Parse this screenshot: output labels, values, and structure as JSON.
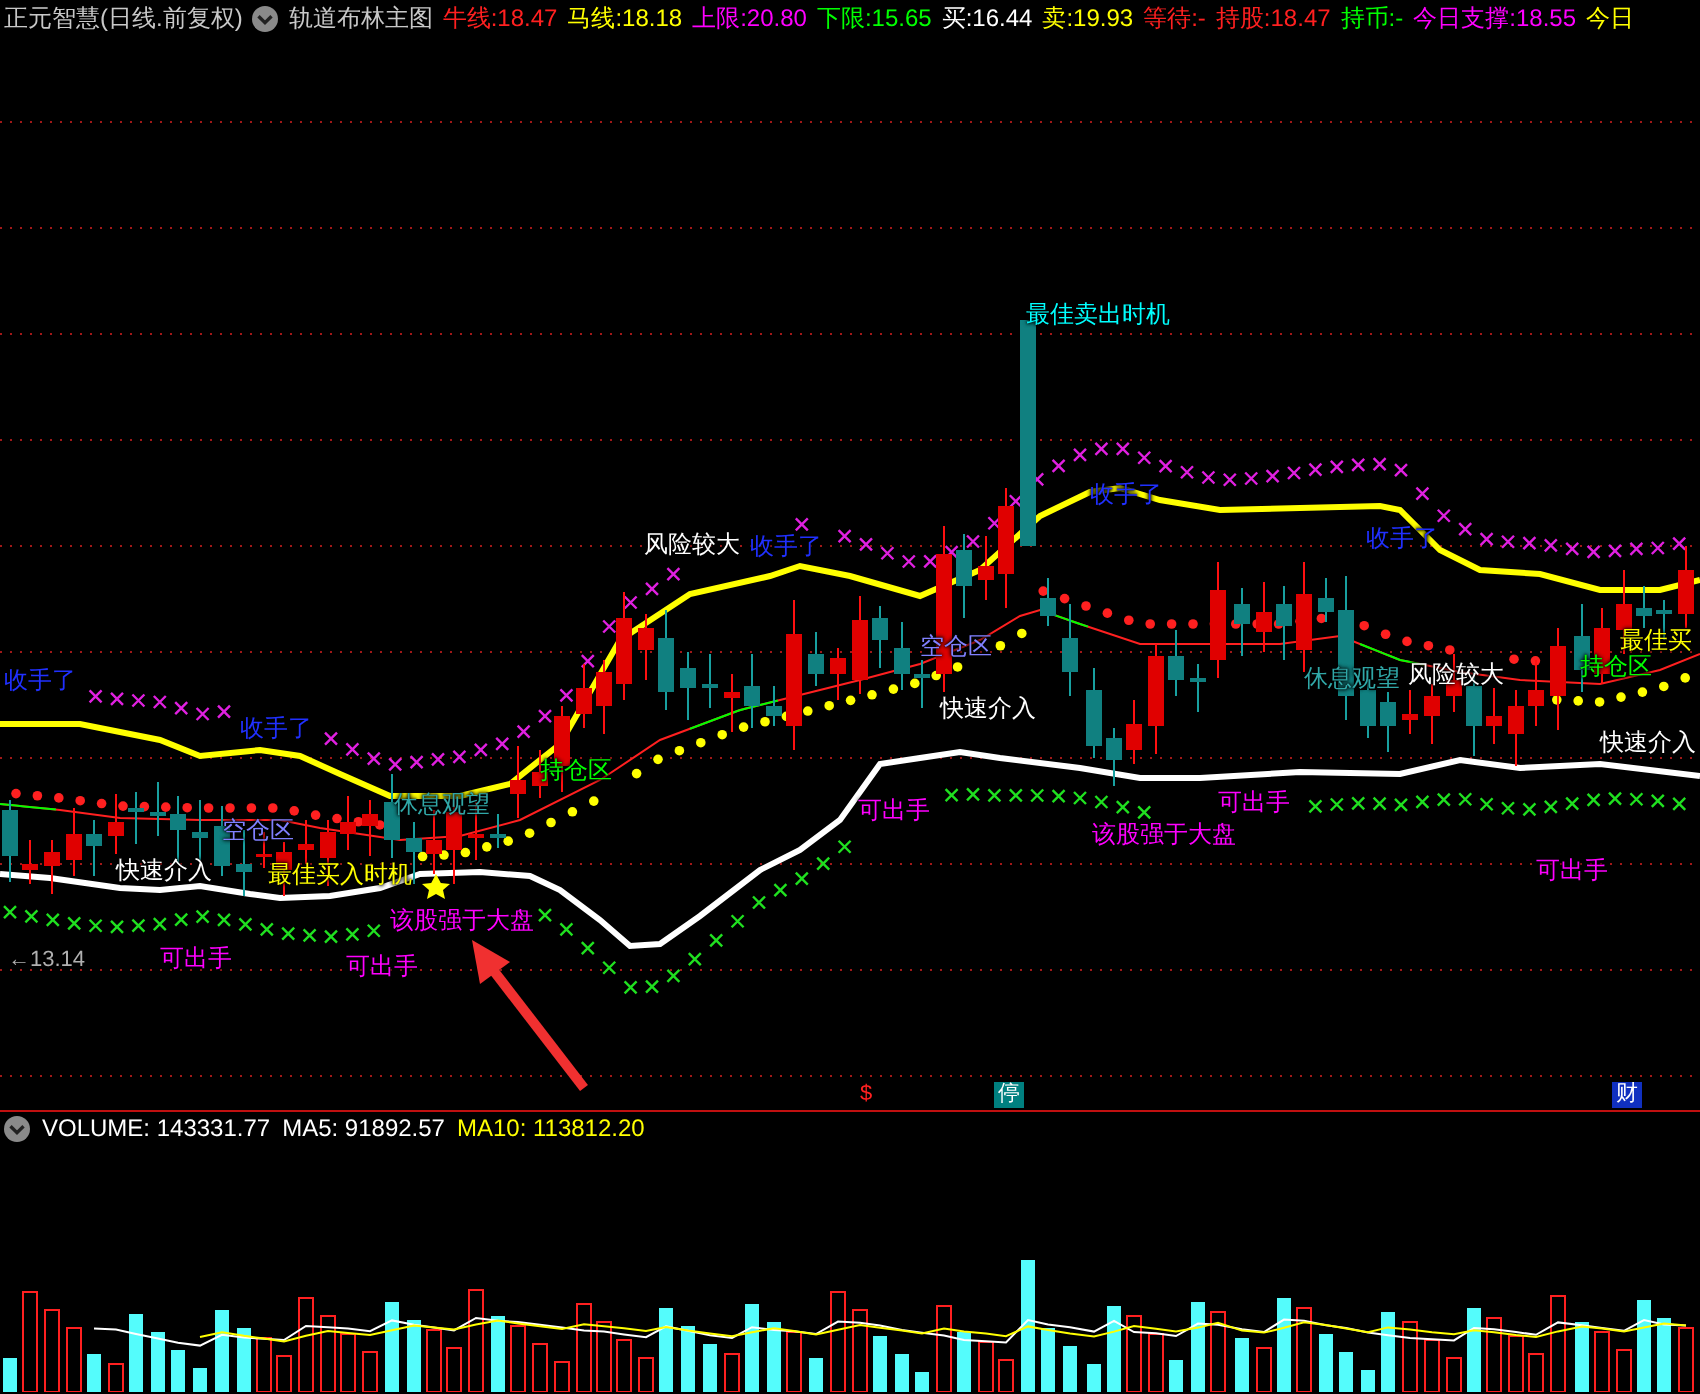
{
  "header": {
    "stock": "正元智慧(日线.前复权)",
    "indicator": "轨道布林主图",
    "items": [
      {
        "text": "牛线:18.47",
        "color": "#ff2020"
      },
      {
        "text": "马线:18.18",
        "color": "#ffff00"
      },
      {
        "text": "上限:20.80",
        "color": "#ff00ff"
      },
      {
        "text": "下限:15.65",
        "color": "#00ff00"
      },
      {
        "text": "买:16.44",
        "color": "#ffffff"
      },
      {
        "text": "卖:19.93",
        "color": "#ffff00"
      },
      {
        "text": "等待:-",
        "color": "#ff2020"
      },
      {
        "text": "持股:18.47",
        "color": "#ff2020"
      },
      {
        "text": "持币:-",
        "color": "#00ff00"
      },
      {
        "text": "今日支撑:18.55",
        "color": "#ff00ff"
      },
      {
        "text": "今日",
        "color": "#ffff00"
      }
    ]
  },
  "chart": {
    "signals": [
      {
        "text": "最佳卖出时机",
        "color": "#00ffff"
      },
      {
        "text": "收手了",
        "color": "#2030ff"
      },
      {
        "text": "风险较大",
        "color": "#ffffff"
      },
      {
        "text": "收手了",
        "color": "#2030ff"
      },
      {
        "text": "收手了",
        "color": "#2030ff"
      },
      {
        "text": "收手了",
        "color": "#2030ff"
      },
      {
        "text": "空仓区",
        "color": "#8080ff"
      },
      {
        "text": "休息观望",
        "color": "#30a8a8"
      },
      {
        "text": "风险较大",
        "color": "#ffffff"
      },
      {
        "text": "持仓区",
        "color": "#00ff00"
      },
      {
        "text": "最佳买",
        "color": "#ffff00"
      },
      {
        "text": "收手了",
        "color": "#2030ff"
      },
      {
        "text": "快速介入",
        "color": "#ffffff"
      },
      {
        "text": "快速介入",
        "color": "#ffffff"
      },
      {
        "text": "持仓区",
        "color": "#00ff00"
      },
      {
        "text": "空仓区",
        "color": "#8080ff"
      },
      {
        "text": "休息观望",
        "color": "#30a8a8"
      },
      {
        "text": "可出手",
        "color": "#ff00ff"
      },
      {
        "text": "该股强于大盘",
        "color": "#ff00ff"
      },
      {
        "text": "可出手",
        "color": "#ff00ff"
      },
      {
        "text": "快速介入",
        "color": "#ffffff"
      },
      {
        "text": "最佳买入时机",
        "color": "#ffff00"
      },
      {
        "text": "可出手",
        "color": "#ff00ff"
      },
      {
        "text": "该股强于大盘",
        "color": "#ff00ff"
      },
      {
        "text": "可出手",
        "color": "#ff00ff"
      },
      {
        "text": "可出手",
        "color": "#ff00ff"
      }
    ],
    "price_label": "←13.14",
    "markers": [
      {
        "text": "$",
        "kind": "plain",
        "color": "#ff2020"
      },
      {
        "text": "停",
        "kind": "boxed",
        "color": "#008080"
      },
      {
        "text": "财",
        "kind": "boxed",
        "color": "#1030c0"
      }
    ]
  },
  "volume": {
    "items": [
      {
        "text": "VOLUME: 143331.77",
        "color": "#ffffff"
      },
      {
        "text": "MA5: 91892.57",
        "color": "#ffffff"
      },
      {
        "text": "MA10: 113812.20",
        "color": "#ffff00"
      }
    ]
  }
}
